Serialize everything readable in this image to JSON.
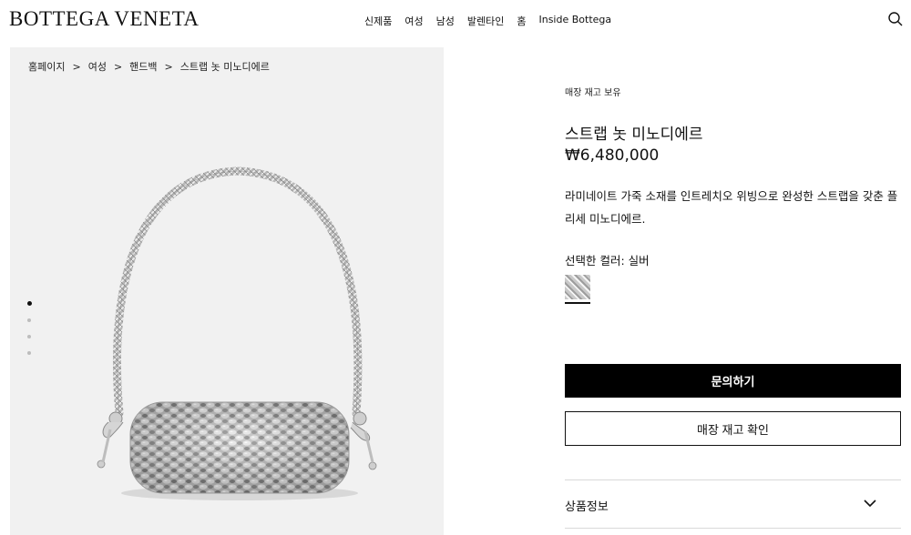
{
  "header": {
    "logo": "BOTTEGA VENETA",
    "nav": [
      "신제품",
      "여성",
      "남성",
      "발렌타인",
      "홈",
      "Inside Bottega"
    ]
  },
  "gallery": {
    "breadcrumb": [
      "홈페이지",
      "여성",
      "핸드백",
      "스트랩 놋 미노디에르"
    ],
    "breadcrumb_separator": ">",
    "image_count": 4,
    "active_image": 1
  },
  "product": {
    "stock_note": "매장 재고 보유",
    "title": "스트랩 놋 미노디에르",
    "price": "₩6,480,000",
    "description": "라미네이트 가죽 소재를 인트레치오 위빙으로 완성한 스트랩을 갖춘 플리세 미노디에르.",
    "color_label": "선택한 컬러: 실버",
    "inquire_label": "문의하기",
    "stock_check_label": "매장 재고 확인",
    "product_info_label": "상품정보"
  },
  "colors": {
    "primary_button_bg": "#000000",
    "gallery_bg": "#f1f1f1"
  }
}
